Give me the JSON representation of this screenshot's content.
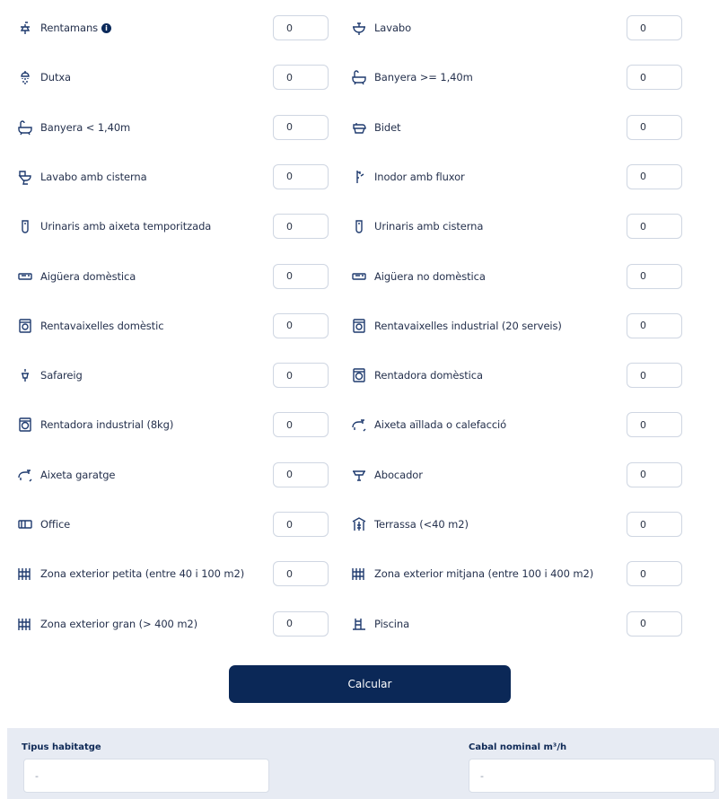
{
  "fixtures": [
    {
      "left": {
        "label": "Rentamans",
        "icon": "faucet-icon",
        "info": true,
        "value": "0"
      },
      "right": {
        "label": "Lavabo",
        "icon": "washbasin-icon",
        "value": "0"
      }
    },
    {
      "left": {
        "label": "Dutxa",
        "icon": "shower-icon",
        "value": "0"
      },
      "right": {
        "label": "Banyera >= 1,40m",
        "icon": "bathtub-icon",
        "value": "0"
      }
    },
    {
      "left": {
        "label": "Banyera < 1,40m",
        "icon": "bathtub-icon",
        "value": "0"
      },
      "right": {
        "label": "Bidet",
        "icon": "bidet-icon",
        "value": "0"
      }
    },
    {
      "left": {
        "label": "Lavabo amb cisterna",
        "icon": "toilet-cistern-icon",
        "value": "0"
      },
      "right": {
        "label": "Inodor amb fluxor",
        "icon": "flush-valve-icon",
        "value": "0"
      }
    },
    {
      "left": {
        "label": "Urinaris amb aixeta temporitzada",
        "icon": "urinal-icon",
        "value": "0"
      },
      "right": {
        "label": "Urinaris amb cisterna",
        "icon": "urinal-icon",
        "value": "0"
      }
    },
    {
      "left": {
        "label": "Aigüera domèstica",
        "icon": "sink-icon",
        "value": "0"
      },
      "right": {
        "label": "Aigüera no domèstica",
        "icon": "sink-icon",
        "value": "0"
      }
    },
    {
      "left": {
        "label": "Rentavaixelles domèstic",
        "icon": "dishwasher-icon",
        "value": "0"
      },
      "right": {
        "label": "Rentavaixelles industrial (20 serveis)",
        "icon": "dishwasher-icon",
        "value": "0"
      }
    },
    {
      "left": {
        "label": "Safareig",
        "icon": "laundry-sink-icon",
        "value": "0"
      },
      "right": {
        "label": "Rentadora domèstica",
        "icon": "washing-machine-icon",
        "value": "0"
      }
    },
    {
      "left": {
        "label": "Rentadora industrial (8kg)",
        "icon": "washing-machine-icon",
        "value": "0"
      },
      "right": {
        "label": "Aixeta aïllada o calefacció",
        "icon": "tap-icon",
        "value": "0"
      }
    },
    {
      "left": {
        "label": "Aixeta garatge",
        "icon": "tap-icon",
        "value": "0"
      },
      "right": {
        "label": "Abocador",
        "icon": "slop-sink-icon",
        "value": "0"
      }
    },
    {
      "left": {
        "label": "Office",
        "icon": "office-icon",
        "value": "0"
      },
      "right": {
        "label": "Terrassa (<40 m2)",
        "icon": "terrace-icon",
        "value": "0"
      }
    },
    {
      "left": {
        "label": "Zona exterior petita (entre 40 i 100 m2)",
        "icon": "garden-zone-icon",
        "value": "0"
      },
      "right": {
        "label": "Zona exterior mitjana (entre 100 i 400 m2)",
        "icon": "garden-zone-icon",
        "value": "0"
      }
    },
    {
      "left": {
        "label": "Zona exterior gran (> 400 m2)",
        "icon": "garden-zone-icon",
        "value": "0"
      },
      "right": {
        "label": "Piscina",
        "icon": "pool-icon",
        "value": "0"
      }
    }
  ],
  "calculate_label": "Calcular",
  "results": {
    "housing_label": "Tipus habitatge",
    "housing_value": "-",
    "flow_label": "Cabal nominal m³/h",
    "flow_value": "-"
  },
  "colors": {
    "primary": "#0b2857",
    "panel": "#e7ebf3",
    "icon": "#1e3a6e"
  }
}
